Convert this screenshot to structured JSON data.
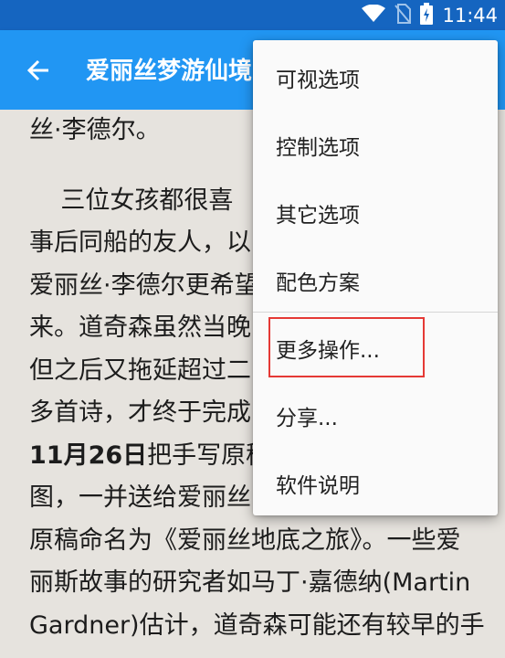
{
  "status_bar": {
    "time": "11:44"
  },
  "app_bar": {
    "title": "爱丽丝梦游仙境"
  },
  "reader": {
    "lines": [
      "丝·李德尔。",
      "    三位女孩都很喜",
      "事后同船的友人，以",
      "爱丽丝·李德尔更希望",
      "来。道奇森虽然当晚",
      "但之后又拖延超过二",
      "多首诗，才终于完成",
      "图，一并送给爱丽丝",
      "原稿命名为《爱丽丝地底之旅》。一些爱",
      "丽斯故事的研究者如马丁·嘉德纳(Martin",
      "Gardner)估计，道奇森可能还有较早的手"
    ],
    "bold_line": {
      "bold": "11月26日",
      "rest": "把手写原稿"
    }
  },
  "menu": {
    "items": [
      "可视选项",
      "控制选项",
      "其它选项",
      "配色方案",
      "更多操作...",
      "分享...",
      "软件说明"
    ]
  }
}
